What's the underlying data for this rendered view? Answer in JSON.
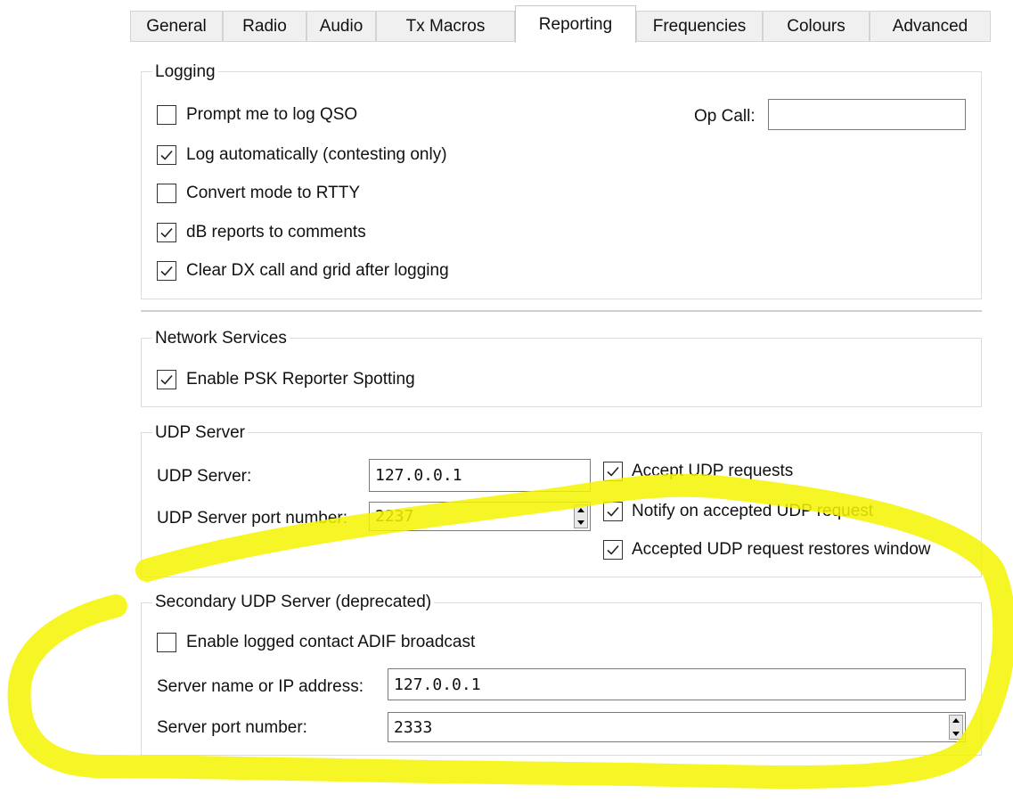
{
  "tabs": [
    "General",
    "Radio",
    "Audio",
    "Tx Macros",
    "Reporting",
    "Frequencies",
    "Colours",
    "Advanced"
  ],
  "active_tab": "Reporting",
  "logging": {
    "title": "Logging",
    "prompt_label": "Prompt me to log QSO",
    "prompt_checked": false,
    "auto_label": "Log automatically (contesting only)",
    "auto_checked": true,
    "rtty_label": "Convert mode to RTTY",
    "rtty_checked": false,
    "db_label": "dB reports to comments",
    "db_checked": true,
    "clear_label": "Clear DX call and grid after logging",
    "clear_checked": true,
    "op_call_label": "Op Call:",
    "op_call_value": ""
  },
  "network": {
    "title": "Network Services",
    "psk_label": "Enable PSK Reporter Spotting",
    "psk_checked": true
  },
  "udp": {
    "title": "UDP Server",
    "server_label": "UDP Server:",
    "server_value": "127.0.0.1",
    "port_label": "UDP Server port number:",
    "port_value": "2237",
    "accept_label": "Accept UDP requests",
    "accept_checked": true,
    "notify_label": "Notify on accepted UDP request",
    "notify_checked": true,
    "restore_label": "Accepted UDP request restores window",
    "restore_checked": true
  },
  "secondary": {
    "title": "Secondary UDP Server (deprecated)",
    "adif_label": "Enable logged contact ADIF broadcast",
    "adif_checked": false,
    "name_label": "Server name or IP address:",
    "name_value": "127.0.0.1",
    "port_label": "Server port number:",
    "port_value": "2333"
  },
  "colors": {
    "highlight": "#f5f500",
    "border": "#dcdcdc"
  }
}
